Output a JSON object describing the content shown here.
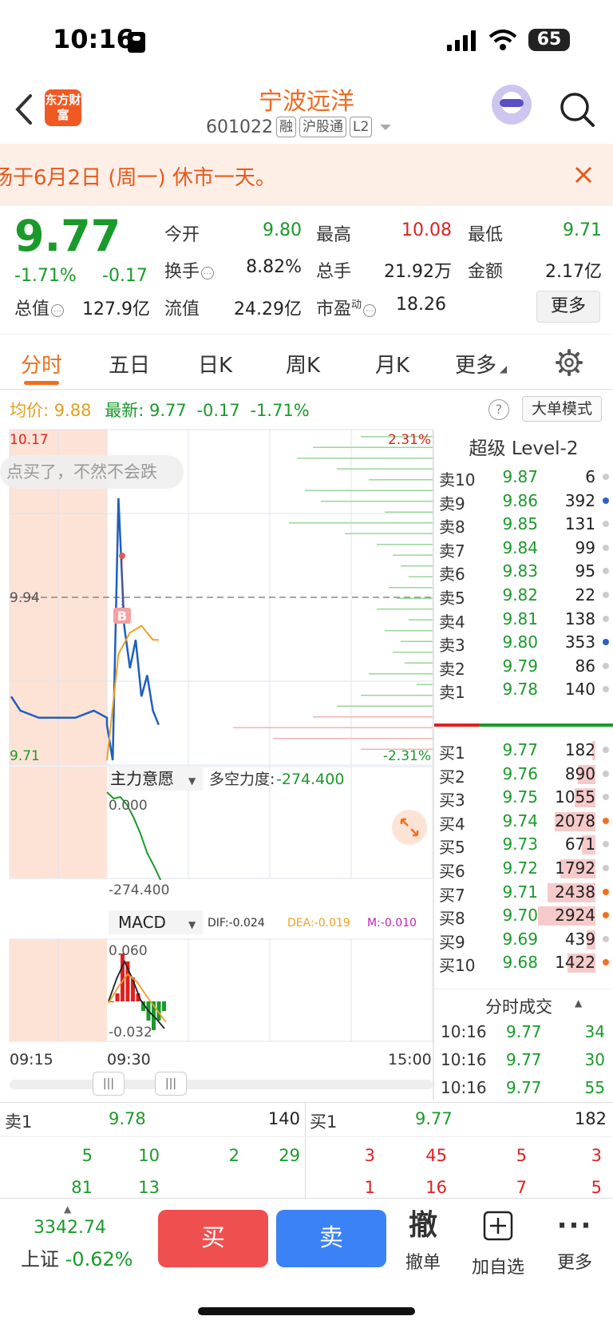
{
  "status": {
    "time": "10:16",
    "battery": "65"
  },
  "header": {
    "app_logo": "东方财富",
    "name": "宁波远洋",
    "code": "601022",
    "tags": [
      "融",
      "沪股通",
      "L2"
    ]
  },
  "notice": {
    "text": "场于6月2日 (周一) 休市一天。"
  },
  "quote": {
    "price": "9.77",
    "pct_change": "-1.71%",
    "abs_change": "-0.17",
    "open_label": "今开",
    "open": "9.80",
    "high_label": "最高",
    "high": "10.08",
    "low_label": "最低",
    "low": "9.71",
    "turnover_label": "换手",
    "turnover": "8.82%",
    "volume_label": "总手",
    "volume": "21.92万",
    "amount_label": "金额",
    "amount": "2.17亿",
    "mktcap_label": "总值",
    "mktcap": "127.9亿",
    "float_label": "流值",
    "float": "24.29亿",
    "pe_label": "市盈",
    "pe_sup": "动",
    "pe": "18.26",
    "more": "更多"
  },
  "tabs": [
    "分时",
    "五日",
    "日K",
    "周K",
    "月K",
    "更多"
  ],
  "chart_info": {
    "avg_label": "均价:",
    "avg": "9.88",
    "latest_label": "最新:",
    "latest": "9.77",
    "latest_change": "-0.17",
    "latest_pct": "-1.71%",
    "big_order_mode": "大单模式",
    "help": "?"
  },
  "chart": {
    "high_label": "10.17",
    "low_label": "9.71",
    "prev_close_label": "9.94",
    "pct_high": "2.31%",
    "pct_low": "-2.31%",
    "ticker_text": "点买了，不然不会跌",
    "buy_marker": "B",
    "time_start": "09:15",
    "time_open": "09:30",
    "time_end": "15:00",
    "handle": "|||",
    "colors": {
      "price": "#1f5fbf",
      "avg": "#f0a020",
      "up": "#e02020",
      "down": "#1a9a2a"
    }
  },
  "chart_data": [
    {
      "type": "line",
      "series": [
        {
          "x": [
            "09:15",
            "09:16",
            "09:18",
            "09:20",
            "09:22",
            "09:24",
            "09:25",
            "09:30",
            "09:31",
            "09:32",
            "09:33",
            "09:34",
            "09:35",
            "09:36",
            "09:37",
            "09:38",
            "09:39"
          ],
          "values": [
            9.8,
            9.78,
            9.77,
            9.77,
            9.77,
            9.78,
            9.77,
            9.76,
            9.71,
            10.08,
            9.9,
            9.84,
            9.88,
            9.8,
            9.83,
            9.78,
            9.76
          ]
        },
        {
          "x": [
            "09:30",
            "09:32",
            "09:34",
            "09:36",
            "09:38",
            "09:39"
          ],
          "values": [
            9.71,
            9.86,
            9.89,
            9.9,
            9.88,
            9.88
          ]
        }
      ],
      "ylim": [
        9.71,
        10.17
      ],
      "ylabel": "",
      "xlabel": ""
    },
    {
      "type": "line",
      "title": "主力意愿",
      "series": [
        {
          "name": "多空力度",
          "values": [
            0.0,
            -20,
            -15,
            -40,
            -80,
            -130,
            -190,
            -230,
            -274.4
          ]
        }
      ],
      "ylim": [
        -274.4,
        0.0
      ]
    },
    {
      "type": "bar",
      "title": "MACD",
      "series": [
        {
          "name": "MACD",
          "values": [
            0.0,
            0.01,
            0.06,
            0.05,
            0.03,
            0.01,
            -0.01,
            -0.02,
            -0.03,
            -0.02,
            -0.01
          ]
        }
      ],
      "ylim": [
        -0.032,
        0.06
      ]
    }
  ],
  "indicator": {
    "main_name": "主力意愿",
    "main_metric": "多空力度:",
    "main_value": "-274.400",
    "main_top": "0.000",
    "main_bottom": "-274.400",
    "macd_name": "MACD",
    "dif": "DIF:-0.024",
    "dea": "DEA:-0.019",
    "m": "M:-0.010",
    "macd_top": "0.060",
    "macd_bottom": "-0.032"
  },
  "level2": {
    "title": "超级 Level-2",
    "asks": [
      {
        "label": "卖10",
        "price": "9.87",
        "vol": "6"
      },
      {
        "label": "卖9",
        "price": "9.86",
        "vol": "392"
      },
      {
        "label": "卖8",
        "price": "9.85",
        "vol": "131"
      },
      {
        "label": "卖7",
        "price": "9.84",
        "vol": "99"
      },
      {
        "label": "卖6",
        "price": "9.83",
        "vol": "95"
      },
      {
        "label": "卖5",
        "price": "9.82",
        "vol": "22"
      },
      {
        "label": "卖4",
        "price": "9.81",
        "vol": "138"
      },
      {
        "label": "卖3",
        "price": "9.80",
        "vol": "353"
      },
      {
        "label": "卖2",
        "price": "9.79",
        "vol": "86"
      },
      {
        "label": "卖1",
        "price": "9.78",
        "vol": "140"
      }
    ],
    "bids": [
      {
        "label": "买1",
        "price": "9.77",
        "vol": "182",
        "fill": 0.06
      },
      {
        "label": "买2",
        "price": "9.76",
        "vol": "890",
        "fill": 0.3
      },
      {
        "label": "买3",
        "price": "9.75",
        "vol": "1055",
        "fill": 0.36
      },
      {
        "label": "买4",
        "price": "9.74",
        "vol": "2078",
        "fill": 0.71
      },
      {
        "label": "买5",
        "price": "9.73",
        "vol": "671",
        "fill": 0.23
      },
      {
        "label": "买6",
        "price": "9.72",
        "vol": "1792",
        "fill": 0.61
      },
      {
        "label": "买7",
        "price": "9.71",
        "vol": "2438",
        "fill": 0.83
      },
      {
        "label": "买8",
        "price": "9.70",
        "vol": "2924",
        "fill": 1.0
      },
      {
        "label": "买9",
        "price": "9.69",
        "vol": "439",
        "fill": 0.15
      },
      {
        "label": "买10",
        "price": "9.68",
        "vol": "1422",
        "fill": 0.49
      }
    ],
    "trades_title": "分时成交",
    "trades": [
      {
        "time": "10:16",
        "price": "9.77",
        "vol": "34"
      },
      {
        "time": "10:16",
        "price": "9.77",
        "vol": "30"
      },
      {
        "time": "10:16",
        "price": "9.77",
        "vol": "55"
      }
    ]
  },
  "book": {
    "sell_label": "卖1",
    "sell_price": "9.78",
    "sell_vol": "140",
    "buy_label": "买1",
    "buy_price": "9.77",
    "buy_vol": "182",
    "sell_queue": [
      "5",
      "10",
      "2",
      "29",
      "81",
      "13"
    ],
    "buy_queue": [
      "3",
      "45",
      "5",
      "3",
      "1",
      "16",
      "7",
      "5"
    ]
  },
  "bottom": {
    "index_value": "3342.74",
    "index_name": "上证",
    "index_change": "-0.62%",
    "buy": "买",
    "sell": "卖",
    "cancel_glyph": "撤",
    "cancel": "撤单",
    "watch": "加自选",
    "more": "更多"
  }
}
